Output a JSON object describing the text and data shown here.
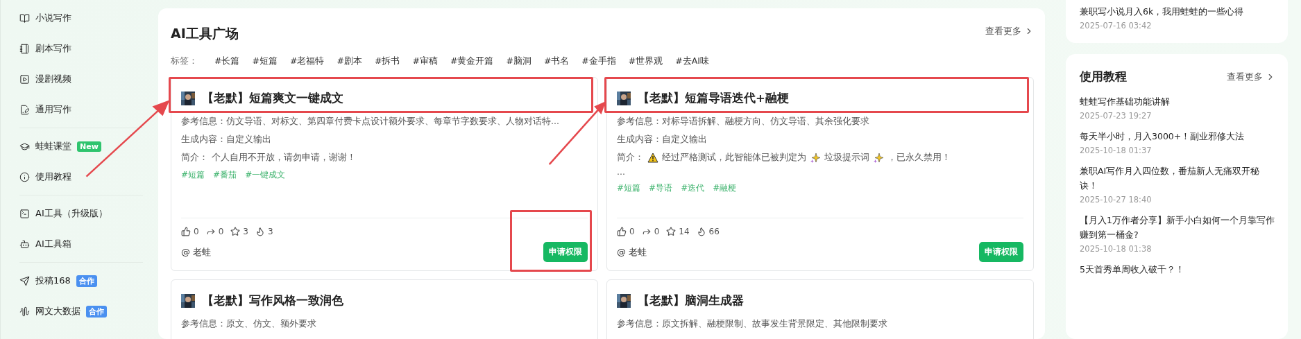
{
  "sidebar": {
    "groups": [
      {
        "items": [
          {
            "label": "小说写作"
          },
          {
            "label": "剧本写作"
          },
          {
            "label": "漫剧视频"
          },
          {
            "label": "通用写作"
          }
        ]
      },
      {
        "items": [
          {
            "label": "蛙蛙课堂",
            "badge": {
              "text": "New",
              "color": "#2fc46e"
            }
          },
          {
            "label": "使用教程"
          }
        ]
      },
      {
        "items": [
          {
            "label": "AI工具（升级版）"
          },
          {
            "label": "AI工具箱"
          }
        ]
      },
      {
        "items": [
          {
            "label": "投稿168",
            "badge": {
              "text": "合作",
              "color": "#4a90f0"
            }
          },
          {
            "label": "网文大数据",
            "badge": {
              "text": "合作",
              "color": "#4a90f0"
            }
          }
        ]
      }
    ]
  },
  "main": {
    "title": "AI工具广场",
    "more": "查看更多",
    "tags_label": "标签：",
    "tags": [
      "#长篇",
      "#短篇",
      "#老福特",
      "#剧本",
      "#拆书",
      "#审稿",
      "#黄金开篇",
      "#脑洞",
      "#书名",
      "#金手指",
      "#世界观",
      "#去AI味"
    ],
    "cards": [
      {
        "title": "【老默】短篇爽文一键成文",
        "highlighted": true,
        "arrow": true,
        "lines": [
          "参考信息：仿文导语、对标文、第四章付费卡点设计额外要求、每章节字数要求、人物对话特...",
          "生成内容：自定义输出"
        ],
        "intro_label": "简介：",
        "intro": [
          {
            "kind": "text",
            "text": "个人自用不开放，请勿申请，谢谢！"
          }
        ],
        "tags": [
          "#短篇",
          "#番茄",
          "#一键成文"
        ],
        "stats": [
          "0",
          "0",
          "3",
          "3"
        ],
        "author": "@ 老蛙",
        "button": "申请权限",
        "button_highlighted": true
      },
      {
        "title": "【老默】短篇导语迭代+融梗",
        "highlighted": true,
        "arrow": true,
        "lines": [
          "参考信息：对标导语拆解、融梗方向、仿文导语、其余强化要求",
          "生成内容：自定义输出"
        ],
        "intro_label": "简介：",
        "intro": [
          {
            "kind": "warning"
          },
          {
            "kind": "text",
            "text": "经过严格测试，此智能体已被判定为"
          },
          {
            "kind": "sparkle"
          },
          {
            "kind": "text",
            "text": "垃圾提示词"
          },
          {
            "kind": "sparkle"
          },
          {
            "kind": "text",
            "text": "，已永久禁用！"
          }
        ],
        "more": "...",
        "tags": [
          "#短篇",
          "#导语",
          "#迭代",
          "#融梗"
        ],
        "stats": [
          "0",
          "0",
          "14",
          "66"
        ],
        "author": "@ 老蛙",
        "button": "申请权限",
        "button_highlighted": false
      },
      {
        "title": "【老默】写作风格一致润色",
        "highlighted": false,
        "arrow": false,
        "lines": [
          "参考信息：原文、仿文、额外要求"
        ]
      },
      {
        "title": "【老默】脑洞生成器",
        "highlighted": false,
        "arrow": false,
        "lines": [
          "参考信息：原文拆解、融梗限制、故事发生背景限定、其他限制要求"
        ]
      }
    ]
  },
  "right": {
    "top_card": {
      "items": [
        {
          "title": "兼职写小说月入6k，我用蛙蛙的一些心得",
          "date": "2025-07-16 03:42"
        }
      ]
    },
    "tutorials": {
      "title": "使用教程",
      "more": "查看更多",
      "items": [
        {
          "title": "蛙蛙写作基础功能讲解",
          "date": "2025-07-23 19:27"
        },
        {
          "title": "每天半小时，月入3000+！副业邪修大法",
          "date": "2025-10-18 01:37"
        },
        {
          "title": "兼职AI写作月入四位数，番茄新人无痛双开秘诀！",
          "date": "2025-10-27 18:40"
        },
        {
          "title": "【月入1万作者分享】新手小白如何一个月靠写作赚到第一桶金?",
          "date": "2025-10-18 01:38"
        },
        {
          "title": "5天首秀单周收入破千？！"
        }
      ]
    }
  }
}
